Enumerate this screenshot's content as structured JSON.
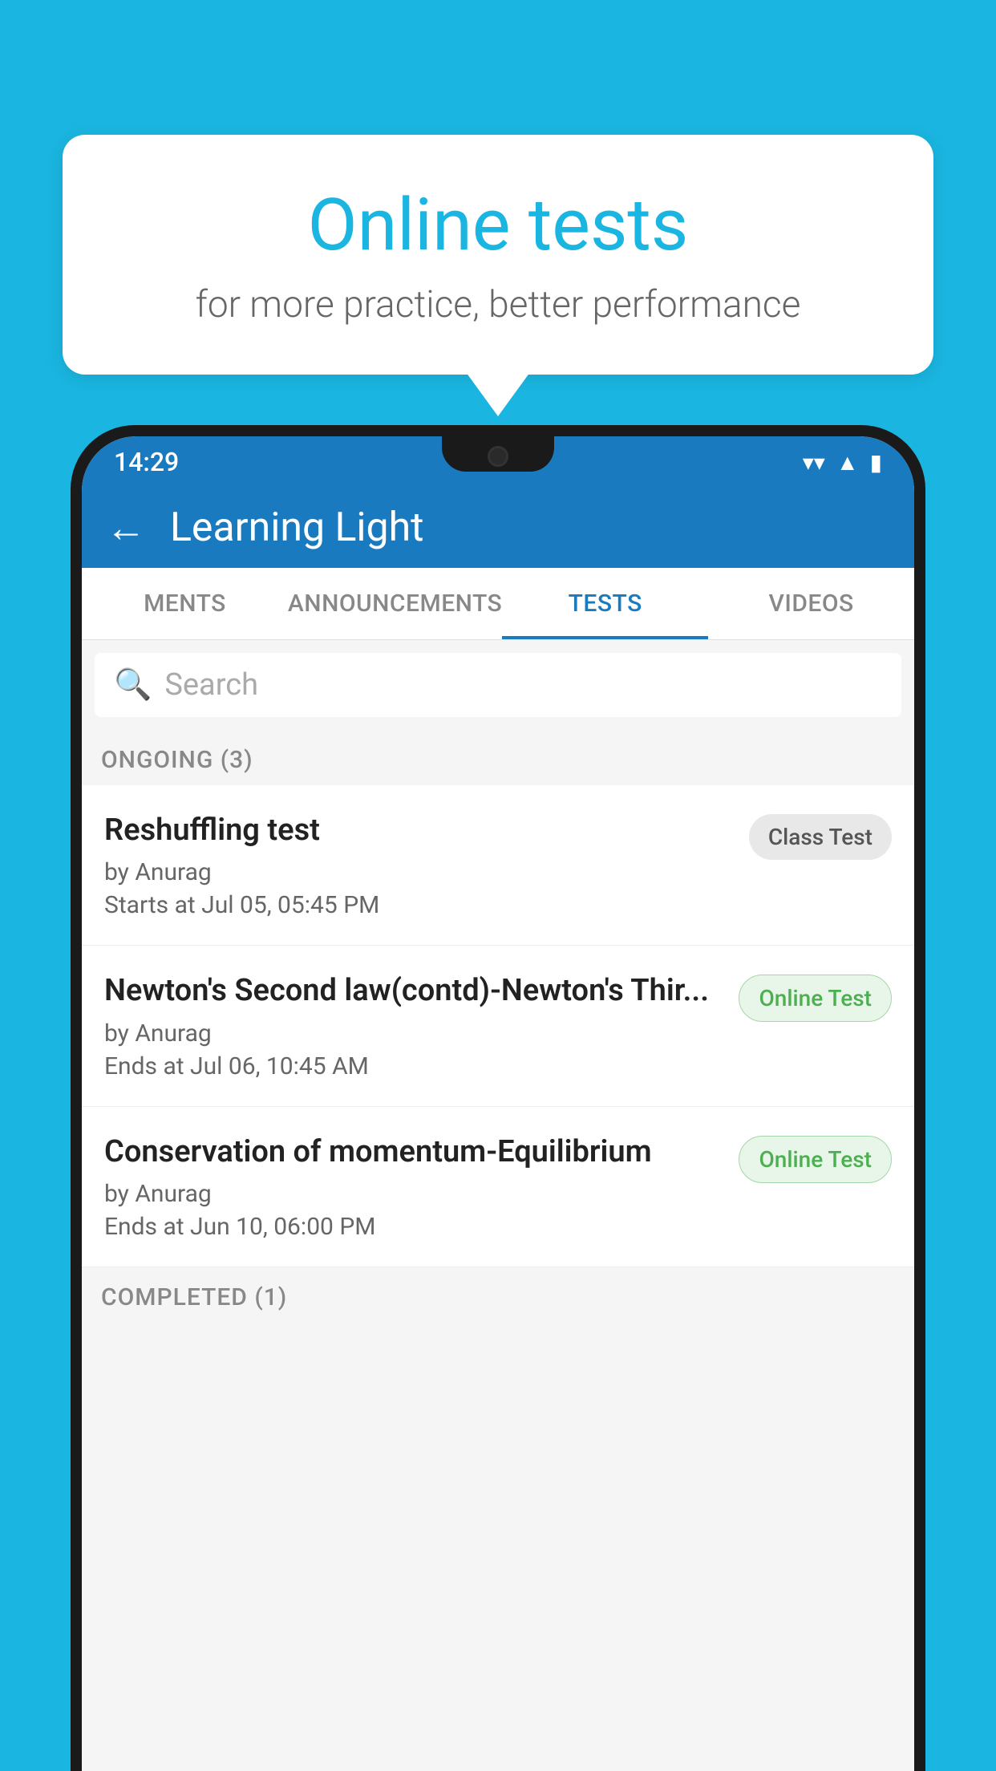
{
  "background_color": "#1ab5e0",
  "bubble": {
    "title": "Online tests",
    "subtitle": "for more practice, better performance"
  },
  "status_bar": {
    "time": "14:29",
    "wifi": "▾",
    "signal": "▲",
    "battery": "▮"
  },
  "app_bar": {
    "back_label": "←",
    "title": "Learning Light"
  },
  "tabs": [
    {
      "label": "MENTS",
      "active": false
    },
    {
      "label": "ANNOUNCEMENTS",
      "active": false
    },
    {
      "label": "TESTS",
      "active": true
    },
    {
      "label": "VIDEOS",
      "active": false
    }
  ],
  "search": {
    "placeholder": "Search"
  },
  "ongoing_section": {
    "header": "ONGOING (3)"
  },
  "tests": [
    {
      "name": "Reshuffling test",
      "author": "by Anurag",
      "time": "Starts at  Jul 05, 05:45 PM",
      "badge": "Class Test",
      "badge_type": "class"
    },
    {
      "name": "Newton's Second law(contd)-Newton's Thir...",
      "author": "by Anurag",
      "time": "Ends at  Jul 06, 10:45 AM",
      "badge": "Online Test",
      "badge_type": "online"
    },
    {
      "name": "Conservation of momentum-Equilibrium",
      "author": "by Anurag",
      "time": "Ends at  Jun 10, 06:00 PM",
      "badge": "Online Test",
      "badge_type": "online"
    }
  ],
  "completed_section": {
    "header": "COMPLETED (1)"
  }
}
